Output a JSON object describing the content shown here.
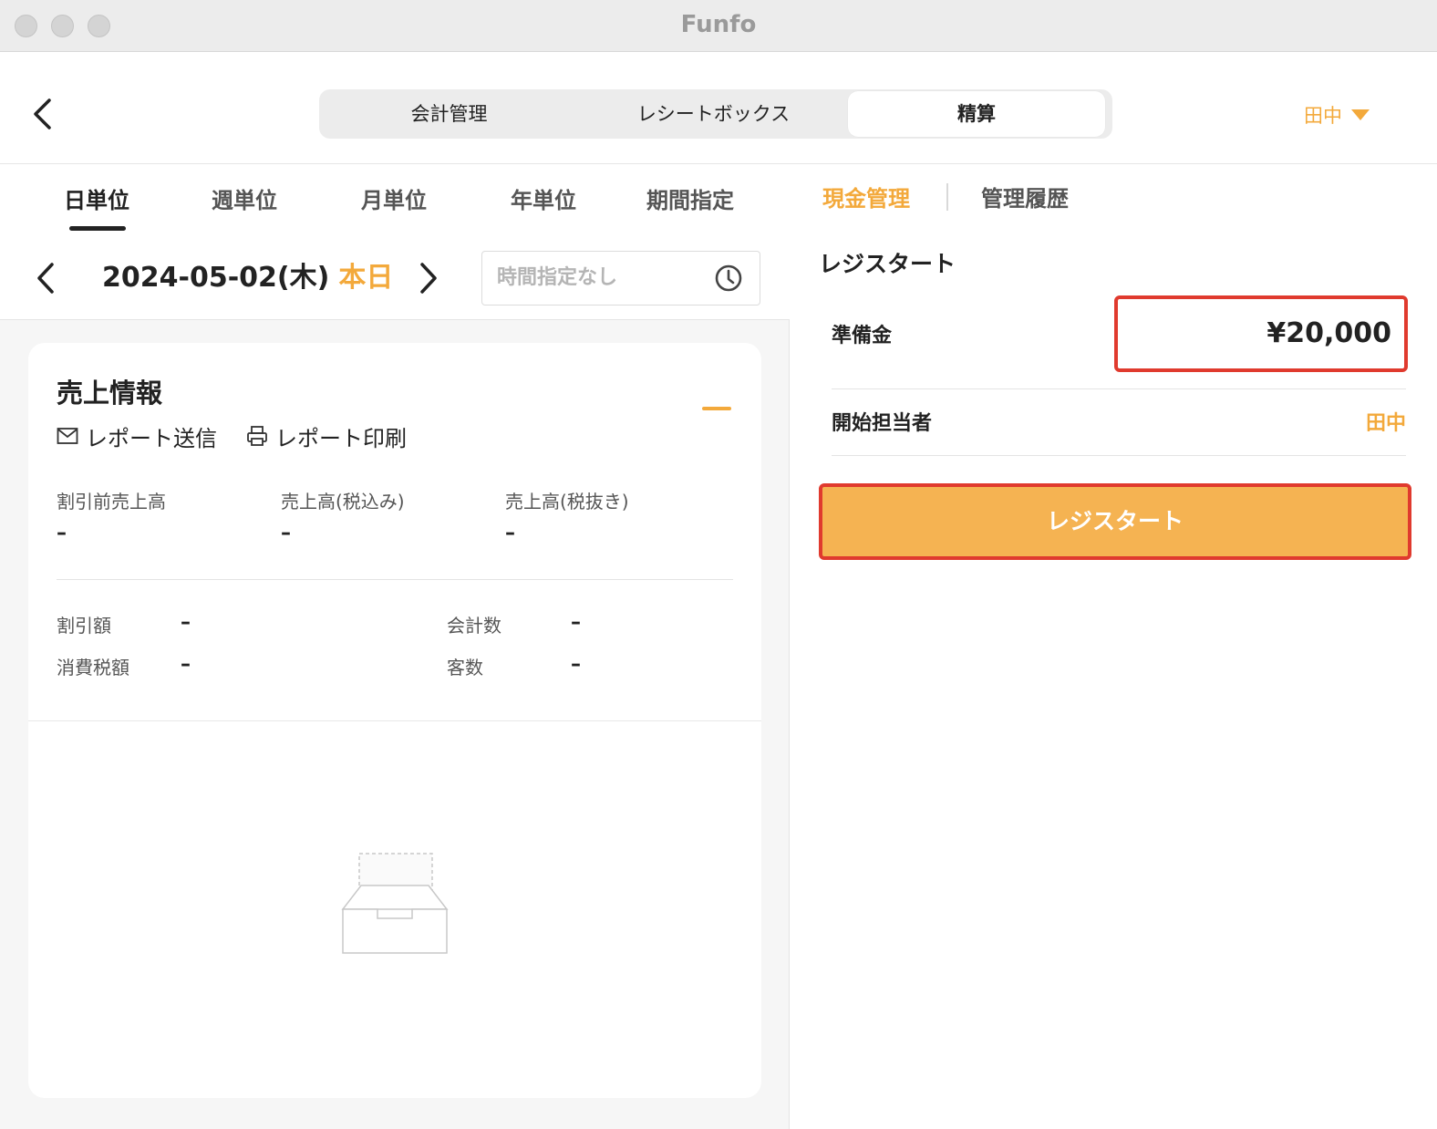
{
  "window": {
    "title": "Funfo"
  },
  "header": {
    "tabs": [
      {
        "label": "会計管理"
      },
      {
        "label": "レシートボックス"
      },
      {
        "label": "精算"
      }
    ],
    "user": "田中"
  },
  "left": {
    "period_tabs": [
      {
        "label": "日単位"
      },
      {
        "label": "週単位"
      },
      {
        "label": "月単位"
      },
      {
        "label": "年単位"
      },
      {
        "label": "期間指定"
      }
    ],
    "active_period": "日単位",
    "date": "2024-05-02(木)",
    "today_label": "本日",
    "time_placeholder": "時間指定なし",
    "card": {
      "title": "売上情報",
      "send_report": "レポート送信",
      "print_report": "レポート印刷",
      "stats_top": [
        {
          "label": "割引前売上高",
          "value": "–"
        },
        {
          "label": "売上高(税込み)",
          "value": "–"
        },
        {
          "label": "売上高(税抜き)",
          "value": "–"
        }
      ],
      "stats_bottom": [
        {
          "label": "割引額",
          "value": "–"
        },
        {
          "label": "会計数",
          "value": "–"
        },
        {
          "label": "消費税額",
          "value": "–"
        },
        {
          "label": "客数",
          "value": "–"
        }
      ]
    }
  },
  "right": {
    "tabs": [
      {
        "label": "現金管理"
      },
      {
        "label": "管理履歴"
      }
    ],
    "section_title": "レジスタート",
    "reserve_label": "準備金",
    "reserve_value": "¥20,000",
    "starter_label": "開始担当者",
    "starter_value": "田中",
    "start_button": "レジスタート"
  },
  "colors": {
    "accent": "#f3a93b",
    "button": "#f5b352",
    "highlight": "#e03a2e"
  }
}
